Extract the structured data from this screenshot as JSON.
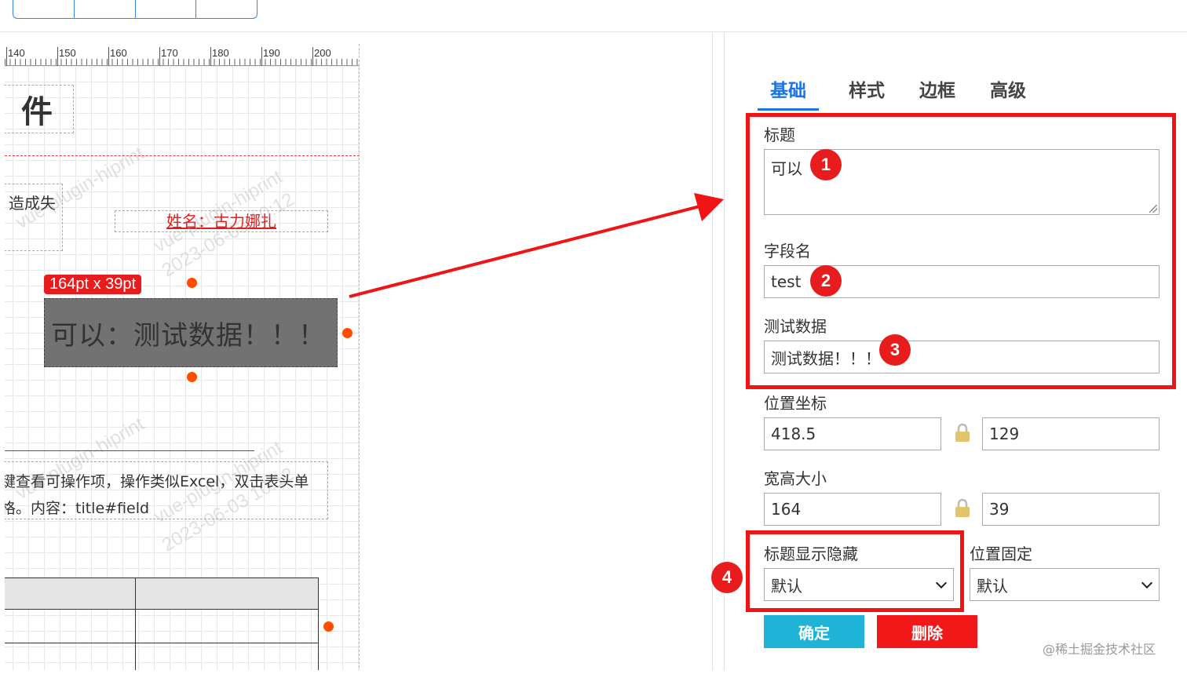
{
  "canvas": {
    "ruler_marks": [
      "140",
      "150",
      "160",
      "170",
      "180",
      "190",
      "200"
    ],
    "title_fragment": "件",
    "loss_text": "造成失",
    "name_text": "姓名：古力娜扎",
    "watermark_text": "vue-plugin-hiprint",
    "watermark_date": "2023-06-03 10:12",
    "size_badge": "164pt x 39pt",
    "selected_text": "可以：测试数据！！！",
    "desc_line1": "键查看可操作项，操作类似Excel，双击表头单",
    "desc_line2": "格。内容：title#field"
  },
  "settings": {
    "tabs": [
      {
        "label": "基础",
        "active": true
      },
      {
        "label": "样式",
        "active": false
      },
      {
        "label": "边框",
        "active": false
      },
      {
        "label": "高级",
        "active": false
      }
    ],
    "title_label": "标题",
    "title_value": "可以",
    "field_label": "字段名",
    "field_value": "test",
    "testdata_label": "测试数据",
    "testdata_value": "测试数据！！！",
    "position_label": "位置坐标",
    "pos_x": "418.5",
    "pos_y": "129",
    "size_label": "宽高大小",
    "width": "164",
    "height": "39",
    "title_visibility_label": "标题显示隐藏",
    "title_visibility_value": "默认",
    "fixed_label": "位置固定",
    "fixed_value": "默认",
    "ok_label": "确定",
    "delete_label": "删除"
  },
  "annotations": [
    "1",
    "2",
    "3",
    "4"
  ],
  "credit": "@稀土掘金技术社区",
  "colors": {
    "accent": "#1a73e8",
    "highlight": "#f01414",
    "handle": "#ff4d00",
    "ok": "#1fb3d8"
  }
}
